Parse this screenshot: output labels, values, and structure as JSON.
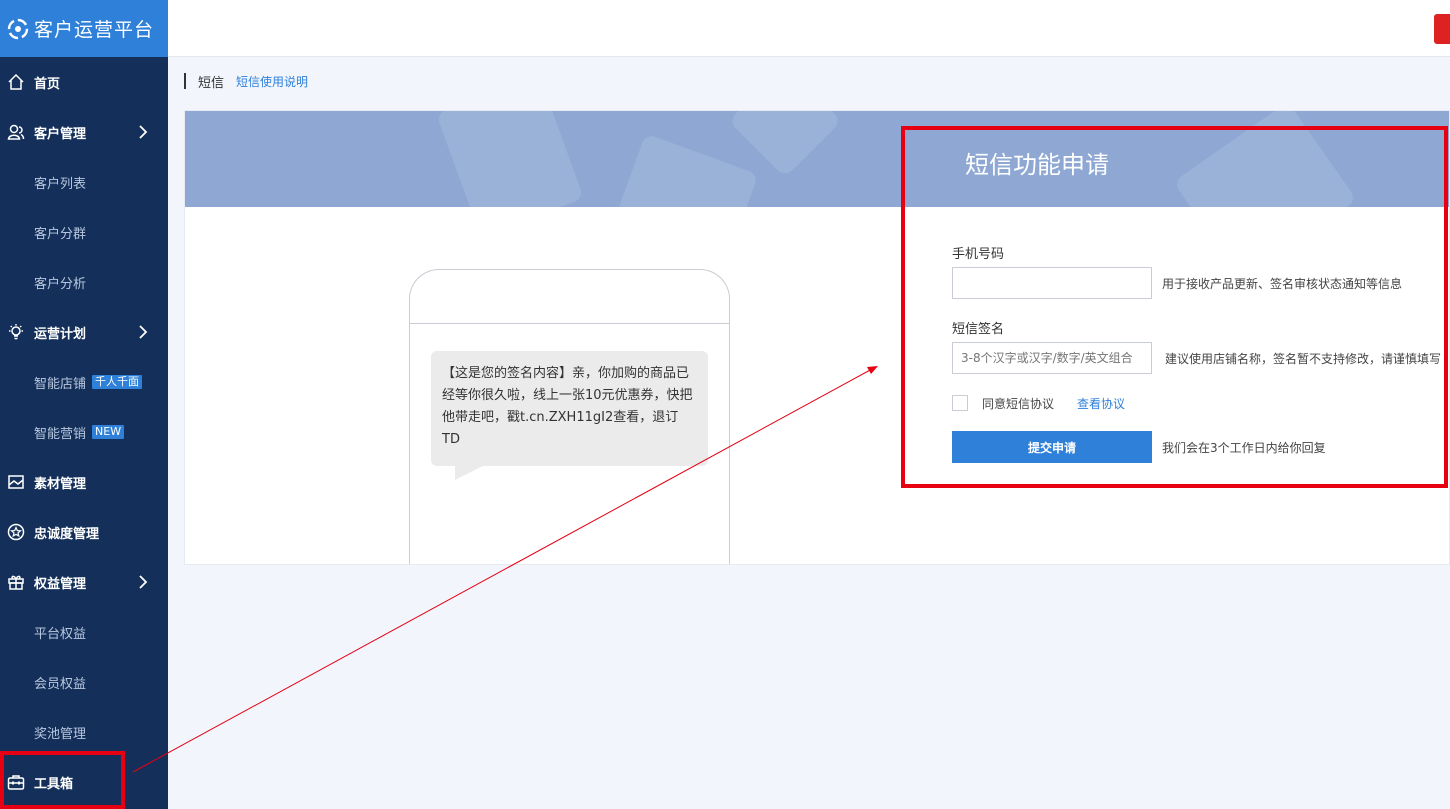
{
  "app": {
    "title": "客户运营平台"
  },
  "sidebar": {
    "items": [
      {
        "label": "首页",
        "icon": "home-icon",
        "type": "main"
      },
      {
        "label": "客户管理",
        "icon": "users-icon",
        "type": "main",
        "expandable": true
      },
      {
        "label": "客户列表",
        "type": "sub"
      },
      {
        "label": "客户分群",
        "type": "sub"
      },
      {
        "label": "客户分析",
        "type": "sub"
      },
      {
        "label": "运营计划",
        "icon": "lightbulb-icon",
        "type": "main",
        "expandable": true
      },
      {
        "label": "智能店铺",
        "type": "sub",
        "badge": "千人千面"
      },
      {
        "label": "智能营销",
        "type": "sub",
        "badge": "NEW"
      },
      {
        "label": "素材管理",
        "icon": "image-icon",
        "type": "main"
      },
      {
        "label": "忠诚度管理",
        "icon": "star-icon",
        "type": "main"
      },
      {
        "label": "权益管理",
        "icon": "gift-icon",
        "type": "main",
        "expandable": true
      },
      {
        "label": "平台权益",
        "type": "sub"
      },
      {
        "label": "会员权益",
        "type": "sub"
      },
      {
        "label": "奖池管理",
        "type": "sub"
      },
      {
        "label": "工具箱",
        "icon": "toolbox-icon",
        "type": "main"
      }
    ]
  },
  "breadcrumb": {
    "title": "短信",
    "link": "短信使用说明"
  },
  "banner": {
    "title": "短信功能申请"
  },
  "preview": {
    "message": "【这是您的签名内容】亲，你加购的商品已经等你很久啦，线上一张10元优惠券，快把他带走吧，戳t.cn.ZXH11gI2查看，退订TD"
  },
  "form": {
    "phone_label": "手机号码",
    "phone_value": "",
    "phone_hint": "用于接收产品更新、签名审核状态通知等信息",
    "signature_label": "短信签名",
    "signature_placeholder": "3-8个汉字或汉字/数字/英文组合",
    "signature_hint": "建议使用店铺名称，签名暂不支持修改，请谨慎填写",
    "agree_label": "同意短信协议",
    "agree_link": "查看协议",
    "submit_label": "提交申请",
    "submit_hint": "我们会在3个工作日内给你回复"
  },
  "colors": {
    "sidebar_bg": "#14305a",
    "accent": "#2f80d9",
    "banner_bg": "#8ea8d3",
    "annotation_red": "#e60012"
  }
}
